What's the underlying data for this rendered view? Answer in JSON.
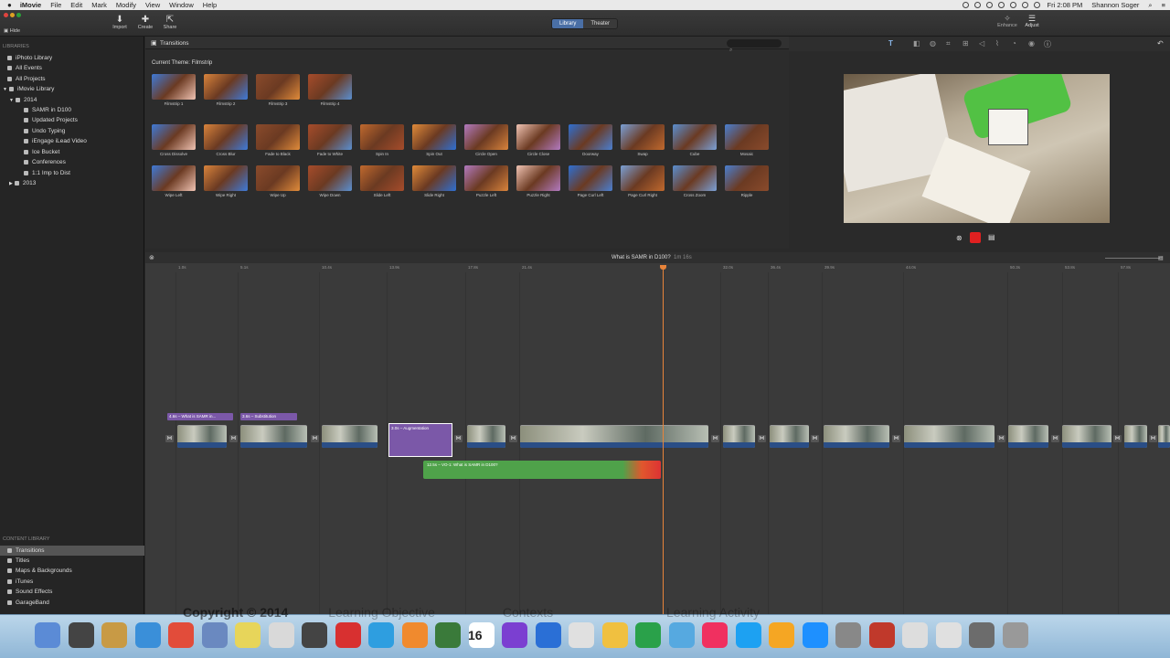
{
  "menubar": {
    "app": "iMovie",
    "items": [
      "File",
      "Edit",
      "Mark",
      "Modify",
      "View",
      "Window",
      "Help"
    ],
    "clock": "Fri 2:08 PM",
    "user": "Shannon Soger"
  },
  "toolbar": {
    "hide": "Hide",
    "import": "Import",
    "create": "Create",
    "share": "Share",
    "library": "Library",
    "theater": "Theater",
    "enhance": "Enhance",
    "adjust": "Adjust"
  },
  "sidebar": {
    "libraries_header": "LIBRARIES",
    "items": [
      "iPhoto Library",
      "All Events",
      "All Projects",
      "iMovie Library",
      "2014",
      "SAMR in D100",
      "Updated Projects",
      "Undo Typing",
      "iEngage iLead Video",
      "Ice Bucket",
      "Conferences",
      "1:1 Imp to Dist",
      "2013"
    ],
    "content_header": "CONTENT LIBRARY",
    "content_items": [
      "Transitions",
      "Titles",
      "Maps & Backgrounds",
      "iTunes",
      "Sound Effects",
      "GarageBand"
    ]
  },
  "browser": {
    "title": "Transitions",
    "theme": "Current Theme: Filmstrip",
    "row1": [
      "Filmstrip 1",
      "Filmstrip 2",
      "Filmstrip 3",
      "Filmstrip 4"
    ],
    "row2": [
      "Cross Dissolve",
      "Cross Blur",
      "Fade to Black",
      "Fade to White",
      "Spin In",
      "Spin Out",
      "Circle Open",
      "Circle Close",
      "Doorway",
      "Swap",
      "Cube",
      "Mosaic"
    ],
    "row3": [
      "Wipe Left",
      "Wipe Right",
      "Wipe Up",
      "Wipe Down",
      "Slide Left",
      "Slide Right",
      "Puzzle Left",
      "Puzzle Right",
      "Page Curl Left",
      "Page Curl Right",
      "Cross Zoom",
      "Ripple"
    ]
  },
  "timeline": {
    "title": "What is SAMR in D100?",
    "duration": "1m 16s",
    "ticks": [
      "1.0s",
      "5.1s",
      "10.4s",
      "13.9s",
      "17.8s",
      "21.4s",
      "32.0s",
      "36.4s",
      "39.9s",
      "44.0s",
      "50.3s",
      "53.8s",
      "57.8s"
    ],
    "tag1": "4.6s – What is SAMR in...",
    "tag2": "3.6s – Substitution",
    "purple_clip": "3.0s – Augmentation",
    "audio_clip": "12.5s – VO-1: What is SAMR in D100?"
  },
  "overlay": {
    "copyright": "Copyright © 2014",
    "o1": "Learning Objective",
    "o2": "Contexts",
    "o3": "Learning Activity"
  },
  "dock_badge": "16"
}
